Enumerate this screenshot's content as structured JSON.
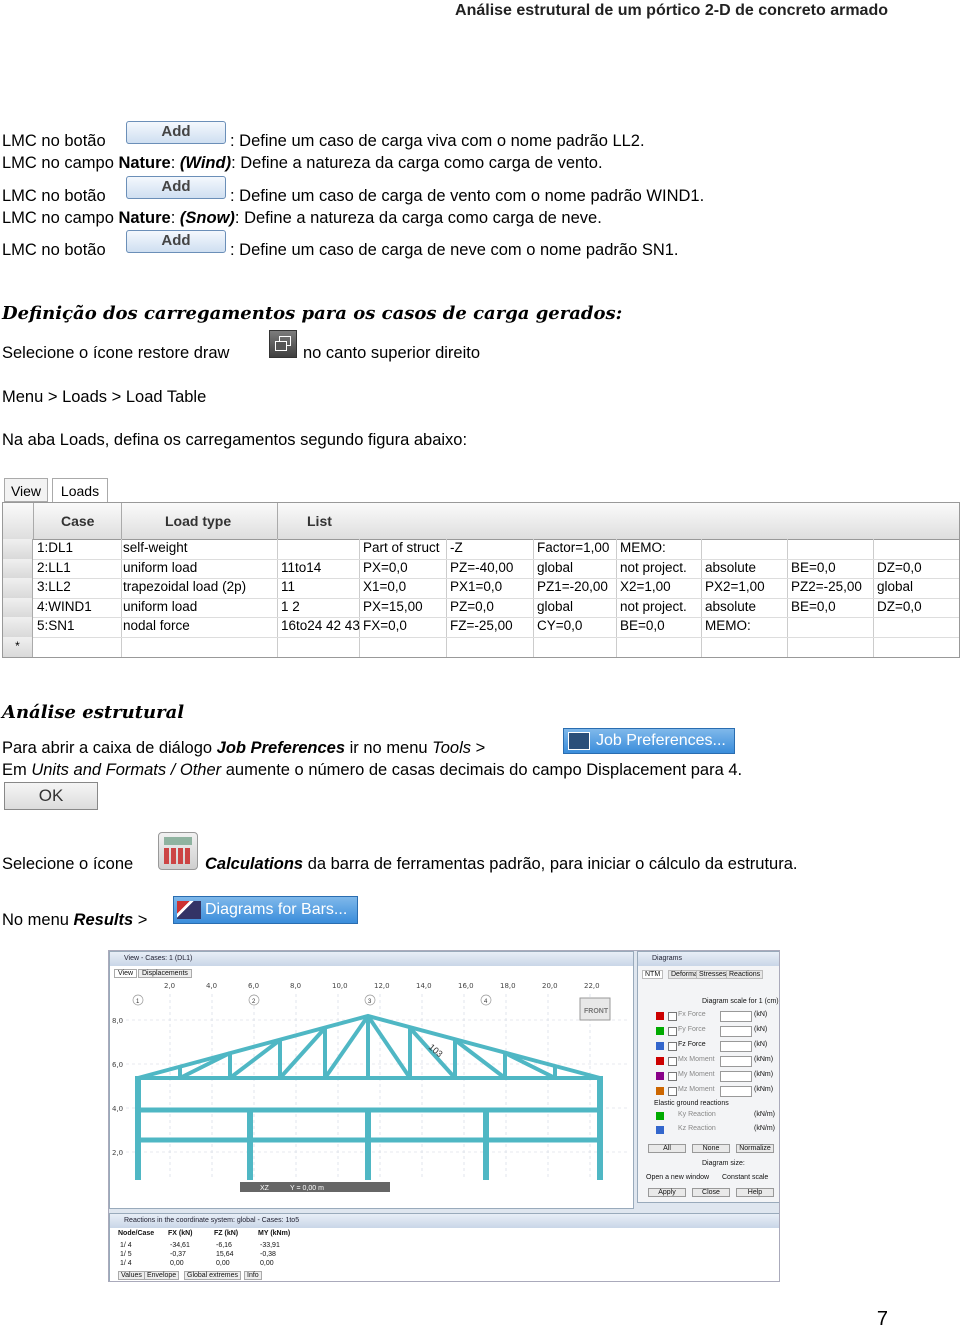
{
  "header": {
    "title": "Análise estrutural de um pórtico 2-D de concreto armado"
  },
  "add_button_label": "Add",
  "steps_add": [
    {
      "prefix": "LMC no botão",
      "suffix": ": Define um caso de carga viva com o nome padrão LL2."
    },
    {
      "prefix": "LMC no campo ",
      "bold": "Nature",
      "mid": ": ",
      "italic_bold": "(Wind)",
      "suffix": ": Define a natureza da carga como carga de vento."
    },
    {
      "prefix": "LMC no botão",
      "suffix": ": Define um caso de carga de vento com o nome padrão WIND1."
    },
    {
      "prefix": "LMC no campo ",
      "bold": "Nature",
      "mid": ": ",
      "italic_bold": "(Snow)",
      "suffix": ": Define a natureza da carga como carga de neve."
    },
    {
      "prefix": "LMC no botão",
      "suffix": ": Define um caso de carga de neve com o nome padrão SN1."
    }
  ],
  "section1": {
    "title": "Definição dos carregamentos para os  casos de carga gerados:",
    "line1_pre": "Selecione o ícone restore draw",
    "line1_post": "no canto superior direito",
    "line2": "Menu > Loads > Load Table",
    "line3": "Na aba Loads, defina os carregamentos segundo figura abaixo:"
  },
  "load_table": {
    "tabs": [
      "View",
      "Loads"
    ],
    "headers": [
      "Case",
      "Load type",
      "List"
    ],
    "rows": [
      [
        "1:DL1",
        "self-weight",
        "",
        "Part of struct",
        "-Z",
        "Factor=1,00",
        "MEMO:",
        "",
        "",
        ""
      ],
      [
        "2:LL1",
        "uniform load",
        "11to14",
        "PX=0,0",
        "PZ=-40,00",
        "global",
        "not project.",
        "absolute",
        "BE=0,0",
        "DZ=0,0"
      ],
      [
        "3:LL2",
        "trapezoidal load (2p)",
        "11",
        "X1=0,0",
        "PX1=0,0",
        "PZ1=-20,00",
        "X2=1,00",
        "PX2=1,00",
        "PZ2=-25,00",
        "global"
      ],
      [
        "4:WIND1",
        "uniform load",
        "1 2",
        "PX=15,00",
        "PZ=0,0",
        "global",
        "not project.",
        "absolute",
        "BE=0,0",
        "DZ=0,0"
      ],
      [
        "5:SN1",
        "nodal force",
        "16to24 42 43",
        "FX=0,0",
        "FZ=-25,00",
        "CY=0,0",
        "BE=0,0",
        "MEMO:",
        "",
        ""
      ]
    ],
    "new_row_marker": "*"
  },
  "section2": {
    "title": "Análise estrutural",
    "l1_pre": "Para abrir a caixa de diálogo ",
    "l1_b": "Job Preferences",
    "l1_mid": " ir no menu ",
    "l1_i": "Tools",
    "l1_post": " >",
    "job_pref_label": "Job Preferences...",
    "l2_pre": "Em ",
    "l2_i": "Units and Formats / Other",
    "l2_post": " aumente o número de casas decimais do campo Displacement para 4.",
    "ok_label": "OK",
    "l3_pre": "Selecione o ícone",
    "l3_bi": "Calculations",
    "l3_post": " da barra de ferramentas padrão, para iniciar o cálculo da estrutura.",
    "l4_pre": "No menu ",
    "l4_bi": "Results",
    "l4_post": " >",
    "diagrams_label": "Diagrams for Bars..."
  },
  "screenshot": {
    "view_title": "View - Cases: 1 (DL1)",
    "view_tabs": [
      "View",
      "Displacements"
    ],
    "diag_title": "Diagrams",
    "diag_tabs": [
      "NTM",
      "Deformation",
      "Stresses",
      "Reactions"
    ],
    "diag_scale": "Diagram scale for 1 (cm)",
    "diag_items": [
      "Fx Force",
      "Fy Force",
      "Fz Force",
      "Mx Moment",
      "My Moment",
      "Mz Moment"
    ],
    "diag_units": [
      "(kN)",
      "(kN)",
      "(kN)",
      "(kNm)",
      "(kNm)",
      "(kNm)"
    ],
    "elastic_label": "Elastic ground reactions",
    "elastic_items": [
      "Ky Reaction",
      "Kz Reaction"
    ],
    "elastic_units": [
      "(kN/m)",
      "(kN/m)"
    ],
    "diag_buttons": [
      "All",
      "None",
      "Normalize"
    ],
    "diag_size": "Diagram size:",
    "open_new": "Open a new window",
    "const_scale": "Constant scale",
    "bottom_buttons": [
      "Apply",
      "Close",
      "Help"
    ],
    "front_label": "FRONT",
    "xz_label": "XZ",
    "y_label": "Y = 0,00 m",
    "reactions_title": "Reactions in the coordinate system: global - Cases: 1to5",
    "reactions_headers": [
      "Node/Case",
      "FX (kN)",
      "FZ (kN)",
      "MY (kNm)"
    ],
    "reactions_rows": [
      [
        "1/  4",
        "-34,61",
        "-6,16",
        "-33,91"
      ],
      [
        "1/  5",
        "-0,37",
        "15,64",
        "-0,38"
      ],
      [
        "1/  4",
        "0,00",
        "0,00",
        "0,00"
      ]
    ],
    "reactions_tabs": [
      "Values",
      "Envelope",
      "Global extremes",
      "Info"
    ],
    "grid_top": [
      "2,0",
      "4,0",
      "6,0",
      "8,0",
      "10,0",
      "12,0",
      "14,0",
      "16,0",
      "18,0",
      "20,0",
      "22,0"
    ],
    "grid_left": [
      "8,0",
      "6,0",
      "4,0",
      "2,0"
    ],
    "circles": [
      "1",
      "2",
      "3",
      "4"
    ],
    "span_label": "103"
  },
  "page_number": "7"
}
